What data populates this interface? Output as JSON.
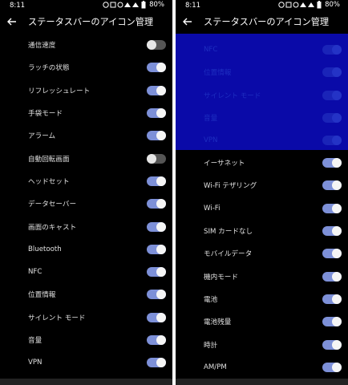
{
  "left_screen": {
    "status": {
      "time": "8:11",
      "battery_pct": "80%"
    },
    "title": "ステータスバーのアイコン管理",
    "items": [
      {
        "label": "通信速度",
        "on": false
      },
      {
        "label": "ラッチの状態",
        "on": true
      },
      {
        "label": "リフレッシュレート",
        "on": true
      },
      {
        "label": "手袋モード",
        "on": true
      },
      {
        "label": "アラーム",
        "on": true
      },
      {
        "label": "自動回転画面",
        "on": false
      },
      {
        "label": "ヘッドセット",
        "on": true
      },
      {
        "label": "データセーバー",
        "on": true
      },
      {
        "label": "画面のキャスト",
        "on": true
      },
      {
        "label": "Bluetooth",
        "on": true
      },
      {
        "label": "NFC",
        "on": true
      },
      {
        "label": "位置情報",
        "on": true
      },
      {
        "label": "サイレント モード",
        "on": true
      },
      {
        "label": "音量",
        "on": true
      },
      {
        "label": "VPN",
        "on": true
      }
    ]
  },
  "right_screen": {
    "status": {
      "time": "8:11",
      "battery_pct": "80%"
    },
    "title": "ステータスバーのアイコン管理",
    "highlight_color": "#0a0aa8",
    "highlighted_items": [
      {
        "label": "NFC",
        "on": true
      },
      {
        "label": "位置情報",
        "on": true
      },
      {
        "label": "サイレント モード",
        "on": true
      },
      {
        "label": "音量",
        "on": true
      },
      {
        "label": "VPN",
        "on": true
      }
    ],
    "items": [
      {
        "label": "イーサネット",
        "on": true
      },
      {
        "label": "Wi-Fi テザリング",
        "on": true
      },
      {
        "label": "Wi-Fi",
        "on": true
      },
      {
        "label": "SIM カードなし",
        "on": true
      },
      {
        "label": "モバイルデータ",
        "on": true
      },
      {
        "label": "機内モード",
        "on": true
      },
      {
        "label": "電池",
        "on": true
      },
      {
        "label": "電池残量",
        "on": true
      },
      {
        "label": "時計",
        "on": true
      },
      {
        "label": "AM/PM",
        "on": true
      }
    ]
  }
}
